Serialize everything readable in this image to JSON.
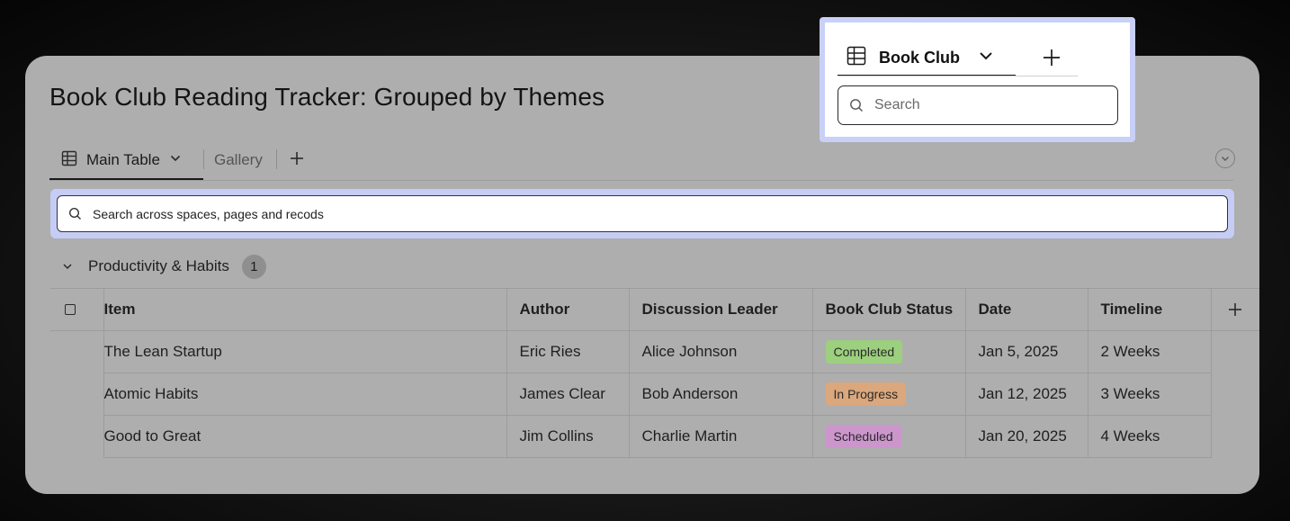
{
  "page": {
    "title": "Book Club Reading Tracker: Grouped by Themes"
  },
  "tabs": {
    "main_label": "Main Table",
    "gallery_label": "Gallery"
  },
  "search": {
    "placeholder": "Search across spaces, pages and recods"
  },
  "group": {
    "title": "Productivity & Habits",
    "count": "1"
  },
  "table": {
    "columns": [
      "Item",
      "Author",
      "Discussion Leader",
      "Book Club Status",
      "Date",
      "Timeline"
    ],
    "rows": [
      {
        "item": "The Lean Startup",
        "author": "Eric Ries",
        "leader": "Alice Johnson",
        "status": "Completed",
        "date": "Jan 5, 2025",
        "timeline": "2 Weeks"
      },
      {
        "item": "Atomic Habits",
        "author": "James Clear",
        "leader": "Bob Anderson",
        "status": "In Progress",
        "date": "Jan 12, 2025",
        "timeline": "3 Weeks"
      },
      {
        "item": "Good to Great",
        "author": "Jim Collins",
        "leader": "Charlie Martin",
        "status": "Scheduled",
        "date": "Jan 20, 2025",
        "timeline": "4 Weeks"
      }
    ]
  },
  "status_colors": {
    "Completed": "#9ccf7e",
    "In Progress": "#dba77c",
    "Scheduled": "#cc96cd"
  },
  "popup": {
    "tab_label": "Book Club",
    "search_placeholder": "Search"
  },
  "icons": {
    "table": "table-grid-icon",
    "chevron": "chevron-down-icon",
    "add": "plus-icon",
    "search": "search-icon",
    "collapse": "circle-chevron-icon",
    "checkbox": "checkbox-icon"
  }
}
